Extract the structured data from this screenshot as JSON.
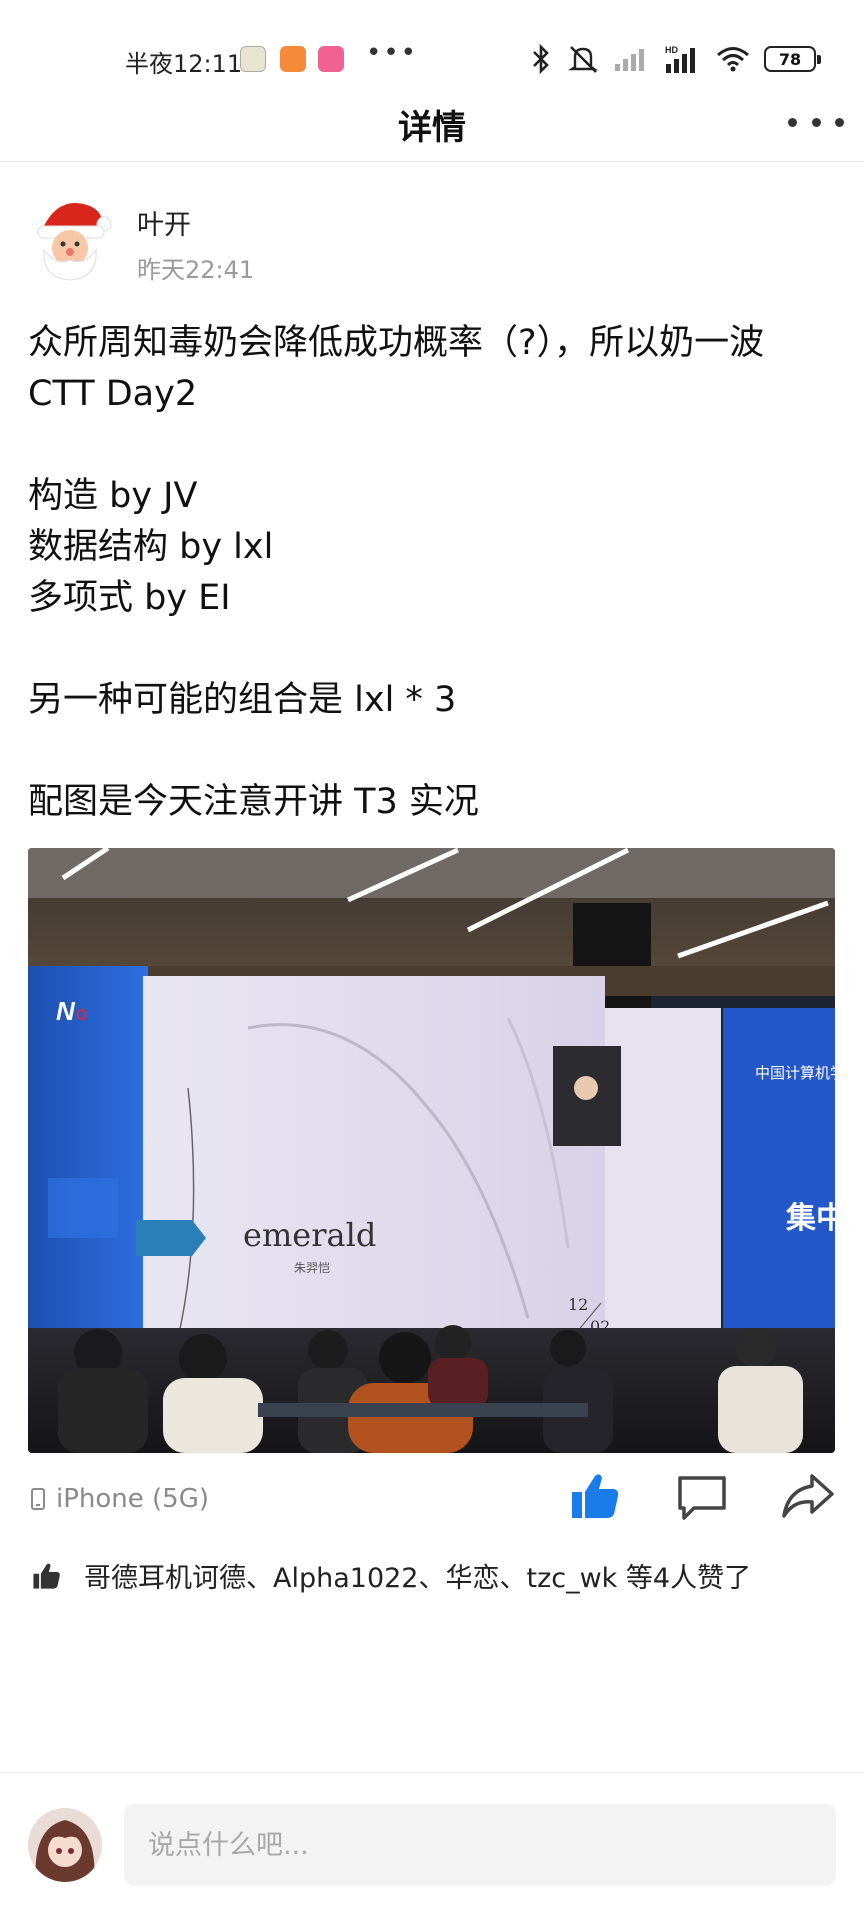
{
  "status_bar": {
    "time": "半夜12:11",
    "battery": "78",
    "app_icons": [
      "game-app-icon",
      "mi-app-icon",
      "bilibili-app-icon"
    ],
    "overflow_dots": "•••"
  },
  "header": {
    "title": "详情",
    "more_icon": "more-horizontal-icon"
  },
  "post": {
    "author": "叶开",
    "time": "昨天22:41",
    "lines": [
      "众所周知毒奶会降低成功概率（?），所以奶一波",
      "CTT Day2",
      "",
      "构造 by JV",
      "数据结构 by lxl",
      "多项式 by EI",
      "",
      "另一种可能的组合是 lxl * 3",
      "",
      "配图是今天注意开讲 T3 实况"
    ],
    "photo": {
      "slide_title": "emerald",
      "slide_subtitle": "朱羿恺",
      "slide_date_top": "12",
      "slide_date_bottom": "02"
    },
    "device": "iPhone (5G)",
    "liked": true,
    "likes_text": "哥德耳机诃德、Alpha1022、华恋、tzc_wk 等4人赞了"
  },
  "comment": {
    "placeholder": "说点什么吧..."
  },
  "colors": {
    "accent_like": "#1a7ce8",
    "muted_text": "#9a9a9a"
  }
}
